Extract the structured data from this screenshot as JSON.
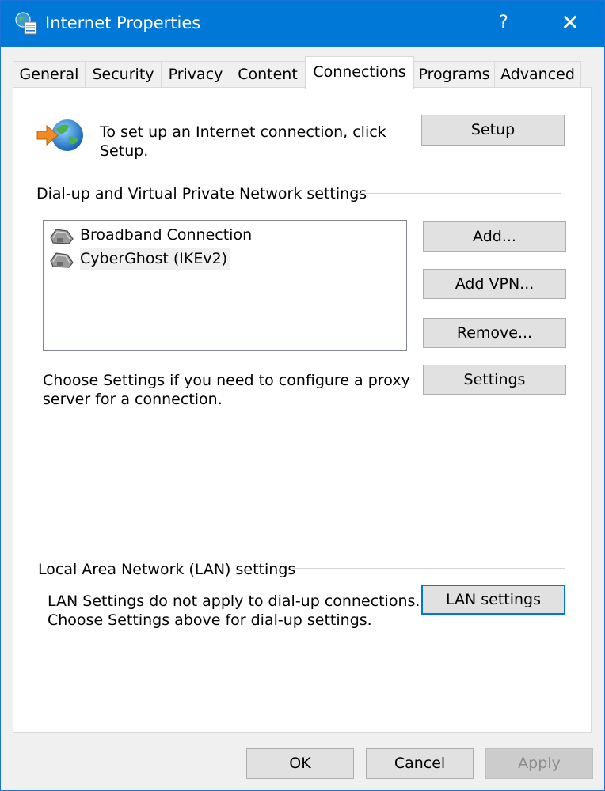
{
  "window": {
    "title": "Internet Properties",
    "help_button": "?",
    "close_button": "✕"
  },
  "tabs": [
    {
      "label": "General"
    },
    {
      "label": "Security"
    },
    {
      "label": "Privacy"
    },
    {
      "label": "Content"
    },
    {
      "label": "Connections",
      "active": true
    },
    {
      "label": "Programs"
    },
    {
      "label": "Advanced"
    }
  ],
  "setup": {
    "text_line1": "To set up an Internet connection, click",
    "text_line2": "Setup.",
    "button": "Setup"
  },
  "vpn": {
    "group_label": "Dial-up and Virtual Private Network settings",
    "connections": [
      {
        "label": "Broadband Connection"
      },
      {
        "label": "CyberGhost (IKEv2)",
        "selected": true
      }
    ],
    "add_button": "Add...",
    "add_vpn_button": "Add VPN...",
    "remove_button": "Remove...",
    "settings_button": "Settings",
    "proxy_text_line1": "Choose Settings if you need to configure a proxy",
    "proxy_text_line2": "server for a connection."
  },
  "lan": {
    "group_label": "Local Area Network (LAN) settings",
    "text_line1": "LAN Settings do not apply to dial-up connections.",
    "text_line2": "Choose Settings above for dial-up settings.",
    "button": "LAN settings"
  },
  "footer": {
    "ok_button": "OK",
    "cancel_button": "Cancel",
    "apply_button": "Apply"
  },
  "colors": {
    "titlebar": "#0078d7",
    "default_button_border": "#0078d7"
  }
}
